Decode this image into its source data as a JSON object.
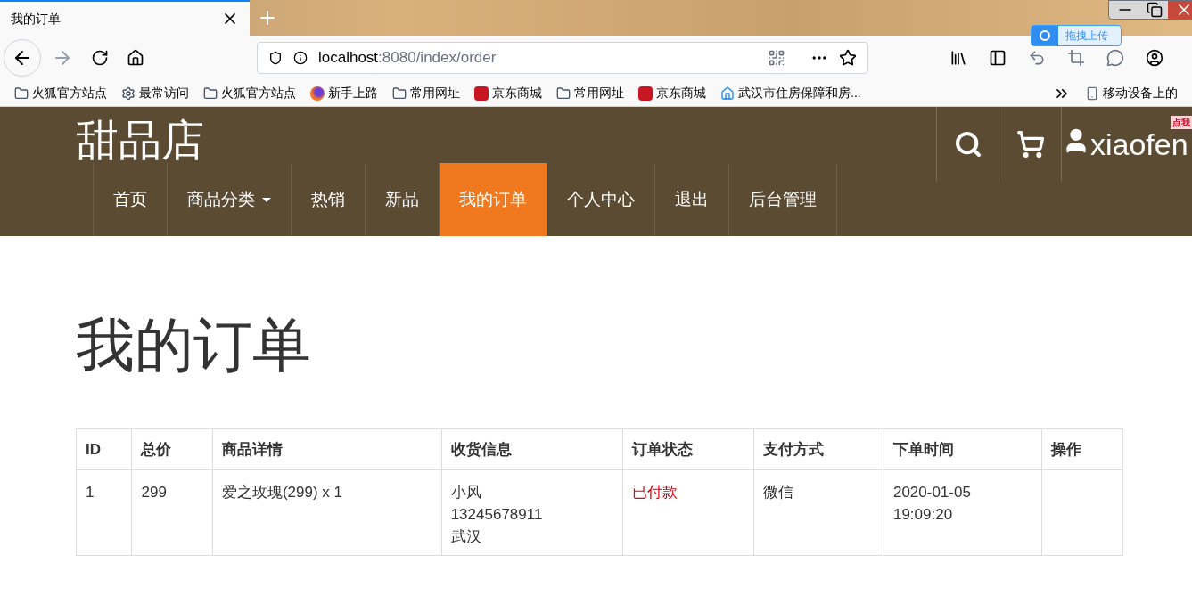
{
  "browser": {
    "tab": {
      "title": "我的订单"
    },
    "url": {
      "host": "localhost",
      "rest": ":8080/index/order"
    },
    "upload_badge": "拖拽上传",
    "bookmarks": [
      {
        "kind": "folder",
        "label": "火狐官方站点"
      },
      {
        "kind": "gear",
        "label": "最常访问"
      },
      {
        "kind": "folder",
        "label": "火狐官方站点"
      },
      {
        "kind": "firefox",
        "label": "新手上路"
      },
      {
        "kind": "folder",
        "label": "常用网址"
      },
      {
        "kind": "jd",
        "label": "京东商城"
      },
      {
        "kind": "folder",
        "label": "常用网址"
      },
      {
        "kind": "jd",
        "label": "京东商城"
      },
      {
        "kind": "home",
        "label": "武汉市住房保障和房..."
      }
    ],
    "mobile_bookmarks": "移动设备上的"
  },
  "site": {
    "brand": "甜品店",
    "user": "xiaofen",
    "sticker": "点我",
    "nav": [
      {
        "label": "首页",
        "selected": false,
        "dropdown": false
      },
      {
        "label": "商品分类",
        "selected": false,
        "dropdown": true
      },
      {
        "label": "热销",
        "selected": false,
        "dropdown": false
      },
      {
        "label": "新品",
        "selected": false,
        "dropdown": false
      },
      {
        "label": "我的订单",
        "selected": true,
        "dropdown": false
      },
      {
        "label": "个人中心",
        "selected": false,
        "dropdown": false
      },
      {
        "label": "退出",
        "selected": false,
        "dropdown": false
      },
      {
        "label": "后台管理",
        "selected": false,
        "dropdown": false
      }
    ]
  },
  "page_title": "我的订单",
  "table": {
    "columns": [
      "ID",
      "总价",
      "商品详情",
      "收货信息",
      "订单状态",
      "支付方式",
      "下单时间",
      "操作"
    ],
    "rows": [
      {
        "id": "1",
        "total": "299",
        "detail": "爱之玫瑰(299) x 1",
        "shipping": [
          "小风",
          "13245678911",
          "武汉"
        ],
        "status": "已付款",
        "color": "#e4000f",
        "payment": "微信",
        "time": [
          "2020-01-05",
          "19:09:20"
        ]
      }
    ]
  }
}
